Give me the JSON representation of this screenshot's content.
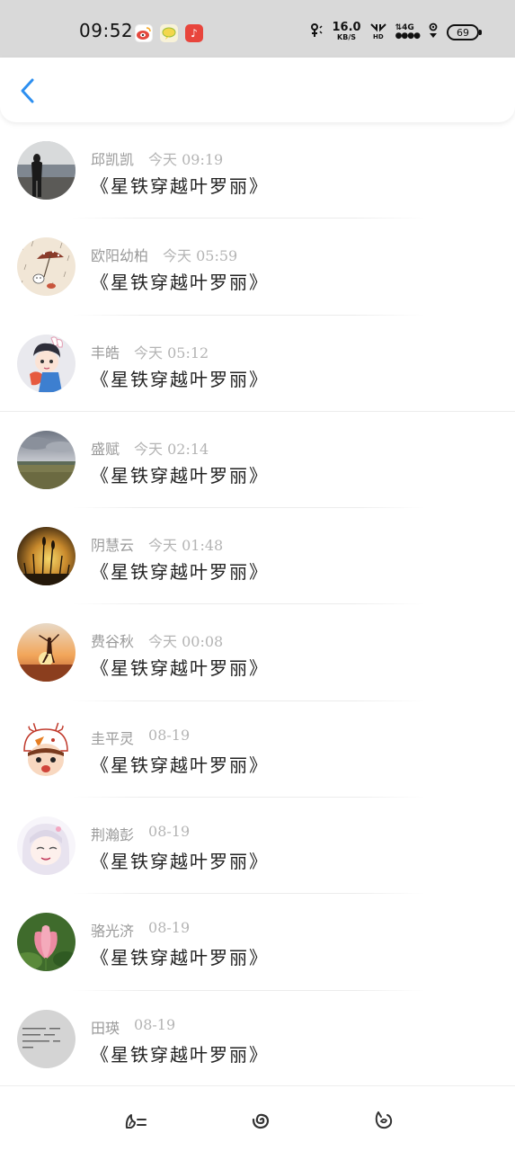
{
  "status_bar": {
    "time": "09:52",
    "apps": [
      {
        "icon": "weibo-icon",
        "color": "#e4483e",
        "glyph": "微"
      },
      {
        "icon": "chat-bubble-icon",
        "color": "#f3d74b",
        "glyph": "♥"
      },
      {
        "icon": "music-icon",
        "color": "#e8453c",
        "glyph": "♪"
      }
    ],
    "net_speed": "16.0",
    "net_unit": "KB/S",
    "hd_label": "HD",
    "network_label": "4G",
    "battery": "69"
  },
  "header": {
    "back_icon": "chevron-left-icon",
    "accent": "#2d8ff0"
  },
  "list": {
    "items": [
      {
        "name": "邱凯凯",
        "time": "今天 09:19",
        "title": "《星铁穿越叶罗丽》",
        "avatar": "girl-sea-photo"
      },
      {
        "name": "欧阳幼柏",
        "time": "今天 05:59",
        "title": "《星铁穿越叶罗丽》",
        "avatar": "rain-umbrella-drawing"
      },
      {
        "name": "丰皓",
        "time": "今天 05:12",
        "title": "《星铁穿越叶罗丽》",
        "avatar": "anime-boy"
      },
      {
        "name": "盛赋",
        "time": "今天 02:14",
        "title": "《星铁穿越叶罗丽》",
        "avatar": "grassland-clouds-photo"
      },
      {
        "name": "阴慧云",
        "time": "今天 01:48",
        "title": "《星铁穿越叶罗丽》",
        "avatar": "sunset-reeds-photo"
      },
      {
        "name": "费谷秋",
        "time": "今天 00:08",
        "title": "《星铁穿越叶罗丽》",
        "avatar": "dancer-sunset-photo"
      },
      {
        "name": "圭平灵",
        "time": "08-19",
        "title": "《星铁穿越叶罗丽》",
        "avatar": "cartoon-bunny-girl"
      },
      {
        "name": "荆瀚彭",
        "time": "08-19",
        "title": "《星铁穿越叶罗丽》",
        "avatar": "anime-white-hair-girl"
      },
      {
        "name": "骆光济",
        "time": "08-19",
        "title": "《星铁穿越叶罗丽》",
        "avatar": "lotus-flower-photo"
      },
      {
        "name": "田瑛",
        "time": "08-19",
        "title": "《星铁穿越叶罗丽》",
        "avatar": "text-quote-image"
      }
    ]
  },
  "bottom_nav": [
    {
      "icon": "home-list-icon"
    },
    {
      "icon": "spiral-icon"
    },
    {
      "icon": "profile-leaf-icon"
    }
  ]
}
